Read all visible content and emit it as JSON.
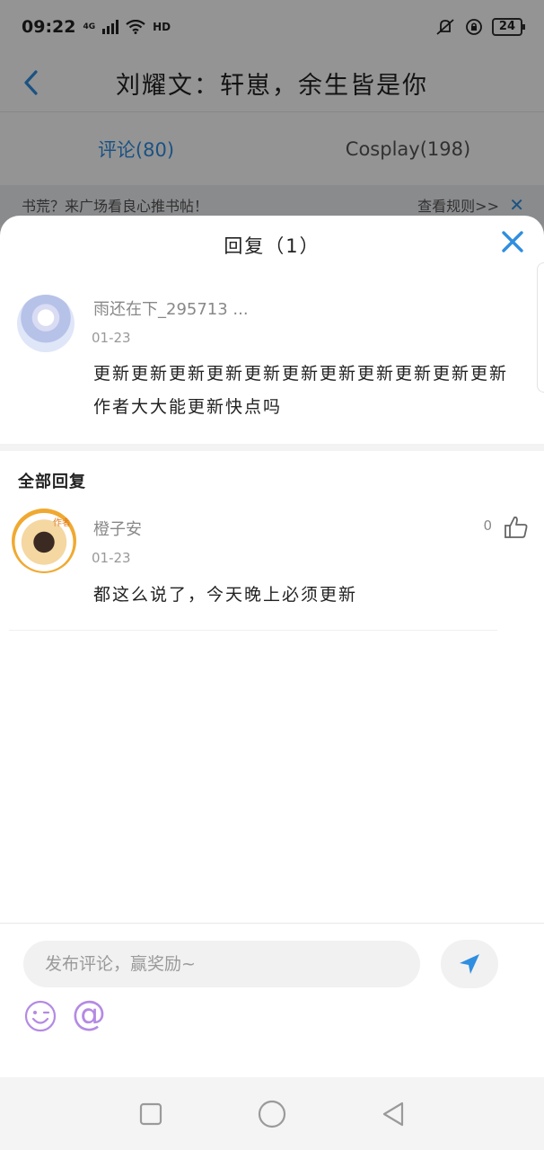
{
  "status": {
    "time": "09:22",
    "network": "4G",
    "hd": "HD",
    "battery": "24"
  },
  "header": {
    "title": "刘耀文：轩崽，余生皆是你"
  },
  "tabs": [
    {
      "label": "评论(80)",
      "active": true
    },
    {
      "label": "Cosplay(198)",
      "active": false
    }
  ],
  "notice": {
    "text": "书荒？来广场看良心推书帖！",
    "rules": "查看规则>>"
  },
  "sheet": {
    "title": "回复（1）",
    "original": {
      "username": "雨还在下_295713 ...",
      "date": "01-23",
      "text": "更新更新更新更新更新更新更新更新更新更新更新作者大大能更新快点吗"
    },
    "section_title": "全部回复",
    "replies": [
      {
        "username": "橙子安",
        "badge": "作者",
        "date": "01-23",
        "likes": "0",
        "text": "都这么说了，今天晚上必须更新"
      }
    ]
  },
  "composer": {
    "placeholder": "发布评论，赢奖励~",
    "at_label": "@"
  },
  "colors": {
    "accent": "#2f8ee0",
    "at_purple": "#b48ae3"
  },
  "icons": {
    "back": "chevron-left-icon",
    "close": "close-icon",
    "like": "thumbs-up-icon",
    "send": "send-icon",
    "emoji": "smile-icon",
    "at": "at-icon"
  }
}
